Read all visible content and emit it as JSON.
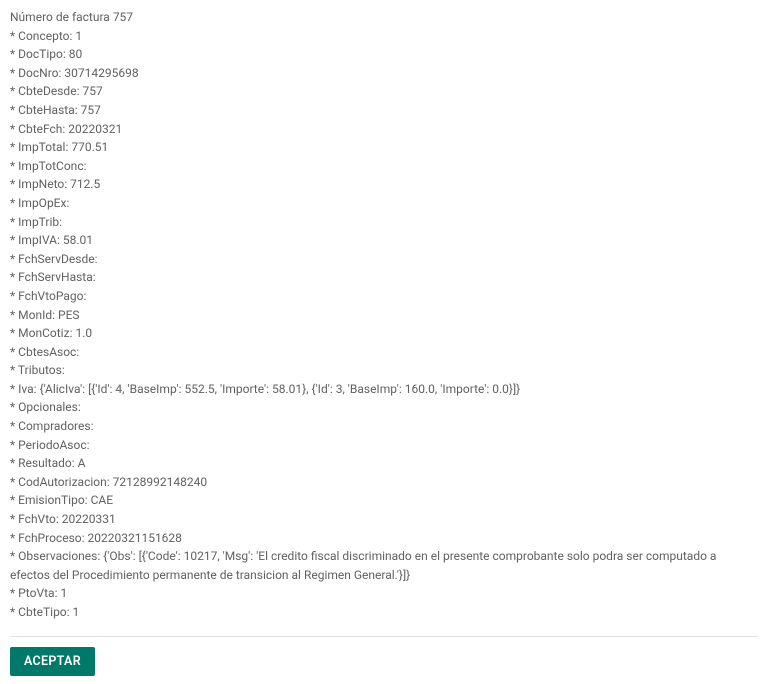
{
  "header": {
    "label": "Número de factura",
    "number": "757"
  },
  "fields": [
    {
      "label": "Concepto",
      "value": "1"
    },
    {
      "label": "DocTipo",
      "value": "80"
    },
    {
      "label": "DocNro",
      "value": "30714295698"
    },
    {
      "label": "CbteDesde",
      "value": "757"
    },
    {
      "label": "CbteHasta",
      "value": "757"
    },
    {
      "label": "CbteFch",
      "value": "20220321"
    },
    {
      "label": "ImpTotal",
      "value": "770.51"
    },
    {
      "label": "ImpTotConc",
      "value": ""
    },
    {
      "label": "ImpNeto",
      "value": "712.5"
    },
    {
      "label": "ImpOpEx",
      "value": ""
    },
    {
      "label": "ImpTrib",
      "value": ""
    },
    {
      "label": "ImpIVA",
      "value": "58.01"
    },
    {
      "label": "FchServDesde",
      "value": ""
    },
    {
      "label": "FchServHasta",
      "value": ""
    },
    {
      "label": "FchVtoPago",
      "value": ""
    },
    {
      "label": "MonId",
      "value": "PES"
    },
    {
      "label": "MonCotiz",
      "value": "1.0"
    },
    {
      "label": "CbtesAsoc",
      "value": ""
    },
    {
      "label": "Tributos",
      "value": ""
    },
    {
      "label": "Iva",
      "value": "{'AlicIva': [{'Id': 4, 'BaseImp': 552.5, 'Importe': 58.01}, {'Id': 3, 'BaseImp': 160.0, 'Importe': 0.0}]}"
    },
    {
      "label": "Opcionales",
      "value": ""
    },
    {
      "label": "Compradores",
      "value": ""
    },
    {
      "label": "PeriodoAsoc",
      "value": ""
    },
    {
      "label": "Resultado",
      "value": "A"
    },
    {
      "label": "CodAutorizacion",
      "value": "72128992148240"
    },
    {
      "label": "EmisionTipo",
      "value": "CAE"
    },
    {
      "label": "FchVto",
      "value": "20220331"
    },
    {
      "label": "FchProceso",
      "value": "20220321151628"
    },
    {
      "label": "Observaciones",
      "value": "{'Obs': [{'Code': 10217, 'Msg': 'El credito fiscal discriminado en el presente comprobante solo podra ser computado a efectos del Procedimiento permanente de transicion al Regimen General.'}]}"
    },
    {
      "label": "PtoVta",
      "value": "1"
    },
    {
      "label": "CbteTipo",
      "value": "1"
    }
  ],
  "buttons": {
    "accept": "ACEPTAR"
  }
}
